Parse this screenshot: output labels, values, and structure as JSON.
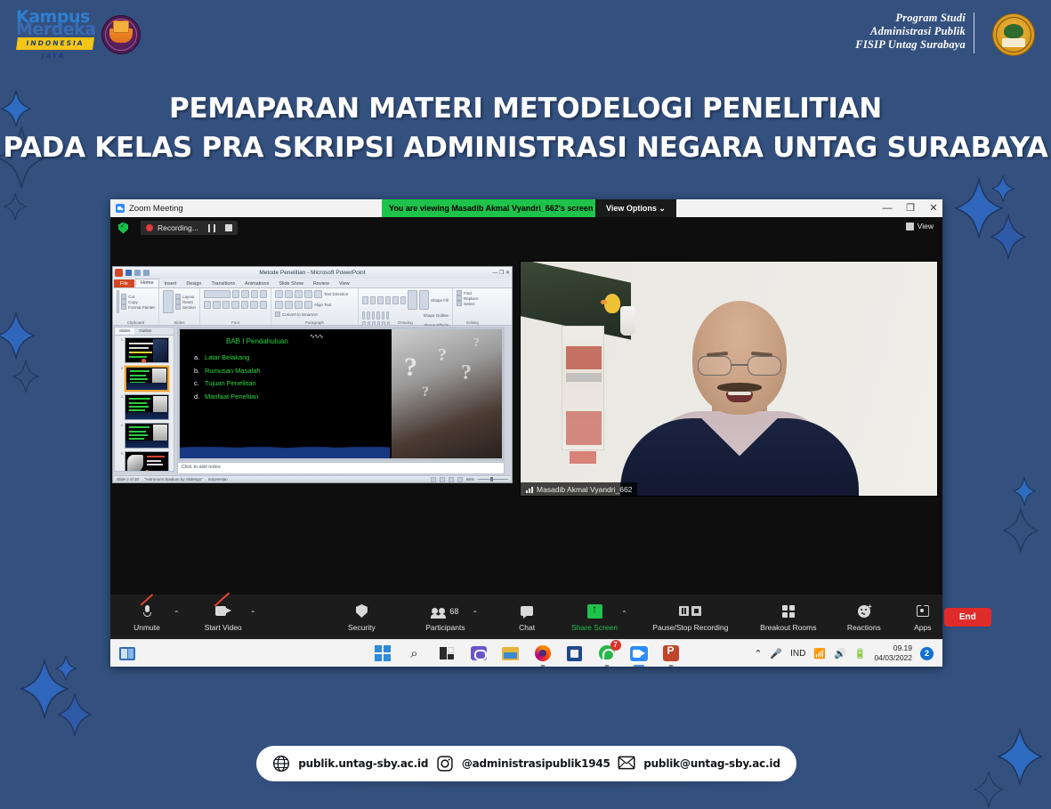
{
  "theme": {
    "bg": "#33507f",
    "accent_green": "#1fc24b",
    "accent_red": "#e02b2b",
    "white": "#ffffff"
  },
  "header": {
    "kampus_merdeka": {
      "line1": "Kampus",
      "line2": "Merdeka",
      "ribbon": "INDONESIA JAYA"
    },
    "prodi": {
      "line1": "Program Studi",
      "line2": "Administrasi Publik",
      "line3": "FISIP Untag Surabaya"
    }
  },
  "title": {
    "line1": "PEMAPARAN MATERI METODELOGI PENELITIAN",
    "line2": "PADA KELAS PRA SKRIPSI ADMINISTRASI NEGARA UNTAG SURABAYA"
  },
  "zoom_window": {
    "titlebar": {
      "app_title": "Zoom Meeting",
      "viewing_banner": "You are viewing Masadib Akmal Vyandri_662's screen",
      "view_options": "View Options",
      "minimize": "—",
      "maximize": "❐",
      "close": "✕"
    },
    "recording_bar": {
      "recording_label": "Recording...",
      "view_label": "View"
    },
    "active_speaker": {
      "name": "Masadib Akmal Vyandri_662"
    },
    "toolbar": {
      "items": [
        {
          "label": "Unmute",
          "icon": "microphone-muted-icon",
          "has_caret": true
        },
        {
          "label": "Start Video",
          "icon": "camera-off-icon",
          "has_caret": true
        },
        {
          "label": "Security",
          "icon": "shield-icon",
          "has_caret": false
        },
        {
          "label": "Participants",
          "icon": "people-icon",
          "has_caret": true,
          "count": "68"
        },
        {
          "label": "Chat",
          "icon": "chat-bubble-icon",
          "has_caret": false
        },
        {
          "label": "Share Screen",
          "icon": "share-screen-icon",
          "has_caret": true,
          "green": true
        },
        {
          "label": "Pause/Stop Recording",
          "icon": "pause-stop-recording-icon",
          "has_caret": false
        },
        {
          "label": "Breakout Rooms",
          "icon": "grid-icon",
          "has_caret": false
        },
        {
          "label": "Reactions",
          "icon": "smiley-plus-icon",
          "has_caret": false
        },
        {
          "label": "Apps",
          "icon": "apps-icon",
          "has_caret": false
        }
      ],
      "end_button": "End"
    }
  },
  "powerpoint": {
    "window_title": "Metode Penelitian  -  Microsoft PowerPoint",
    "tabs": [
      "File",
      "Home",
      "Insert",
      "Design",
      "Transitions",
      "Animations",
      "Slide Show",
      "Review",
      "View"
    ],
    "active_tab": "Home",
    "ribbon_groups": [
      {
        "name": "Clipboard",
        "commands": [
          "Paste",
          "Cut",
          "Copy",
          "Format Painter"
        ]
      },
      {
        "name": "Slides",
        "commands": [
          "New Slide",
          "Layout",
          "Reset",
          "Section"
        ]
      },
      {
        "name": "Font",
        "commands": [
          "B",
          "I",
          "U",
          "S",
          "AV",
          "Aa",
          "A"
        ]
      },
      {
        "name": "Paragraph",
        "commands": [
          "Text Direction",
          "Align Text",
          "Convert to SmartArt"
        ]
      },
      {
        "name": "Drawing",
        "commands": [
          "Arrange",
          "Quick Styles",
          "Shape Fill",
          "Shape Outline",
          "Shape Effects"
        ]
      },
      {
        "name": "Editing",
        "commands": [
          "Find",
          "Replace",
          "Select"
        ]
      }
    ],
    "panel_tabs": [
      "Slides",
      "Outline"
    ],
    "thumbnails": [
      {
        "number": "1",
        "selected": false
      },
      {
        "number": "2",
        "selected": true
      },
      {
        "number": "3",
        "selected": false
      },
      {
        "number": "4",
        "selected": false
      },
      {
        "number": "5",
        "selected": false
      },
      {
        "number": "6",
        "selected": false
      }
    ],
    "slide": {
      "title": "BAB I Pendahuluan",
      "items": [
        {
          "marker": "a.",
          "text": "Latar Belakang"
        },
        {
          "marker": "b.",
          "text": "Rumusan Masalah"
        },
        {
          "marker": "c.",
          "text": "Tujuan Penelitian"
        },
        {
          "marker": "d.",
          "text": "Manfaat Peneltian"
        }
      ]
    },
    "notes_placeholder": "Click to add notes",
    "status": {
      "slide_counter": "Slide 2 of 30",
      "theme": "\"Astronomi Stadium by Slidesgo\"",
      "language": "Indonesian",
      "zoom_level": "66%"
    }
  },
  "taskbar": {
    "task_view": "task-view-icon",
    "apps": [
      {
        "name": "start-icon",
        "badge": ""
      },
      {
        "name": "search-icon",
        "badge": ""
      },
      {
        "name": "widgets-icon",
        "badge": ""
      },
      {
        "name": "teams-icon",
        "badge": ""
      },
      {
        "name": "file-explorer-icon",
        "badge": ""
      },
      {
        "name": "firefox-icon",
        "badge": ""
      },
      {
        "name": "microsoft-store-icon",
        "badge": ""
      },
      {
        "name": "whatsapp-icon",
        "badge": "7"
      },
      {
        "name": "zoom-icon",
        "badge": ""
      },
      {
        "name": "powerpoint-icon",
        "badge": ""
      }
    ],
    "tray": {
      "chevron": "⌃",
      "mic": "microphone-icon",
      "language": "IND",
      "wifi": "wifi-icon",
      "volume": "volume-icon",
      "battery": "battery-icon",
      "time": "09.19",
      "date": "04/03/2022",
      "notification_count": "2"
    }
  },
  "footer": {
    "items": [
      {
        "icon": "globe-icon",
        "text": "publik.untag-sby.ac.id"
      },
      {
        "icon": "instagram-icon",
        "text": "@administrasipublik1945"
      },
      {
        "icon": "envelope-icon",
        "text": "publik@untag-sby.ac.id"
      }
    ]
  }
}
